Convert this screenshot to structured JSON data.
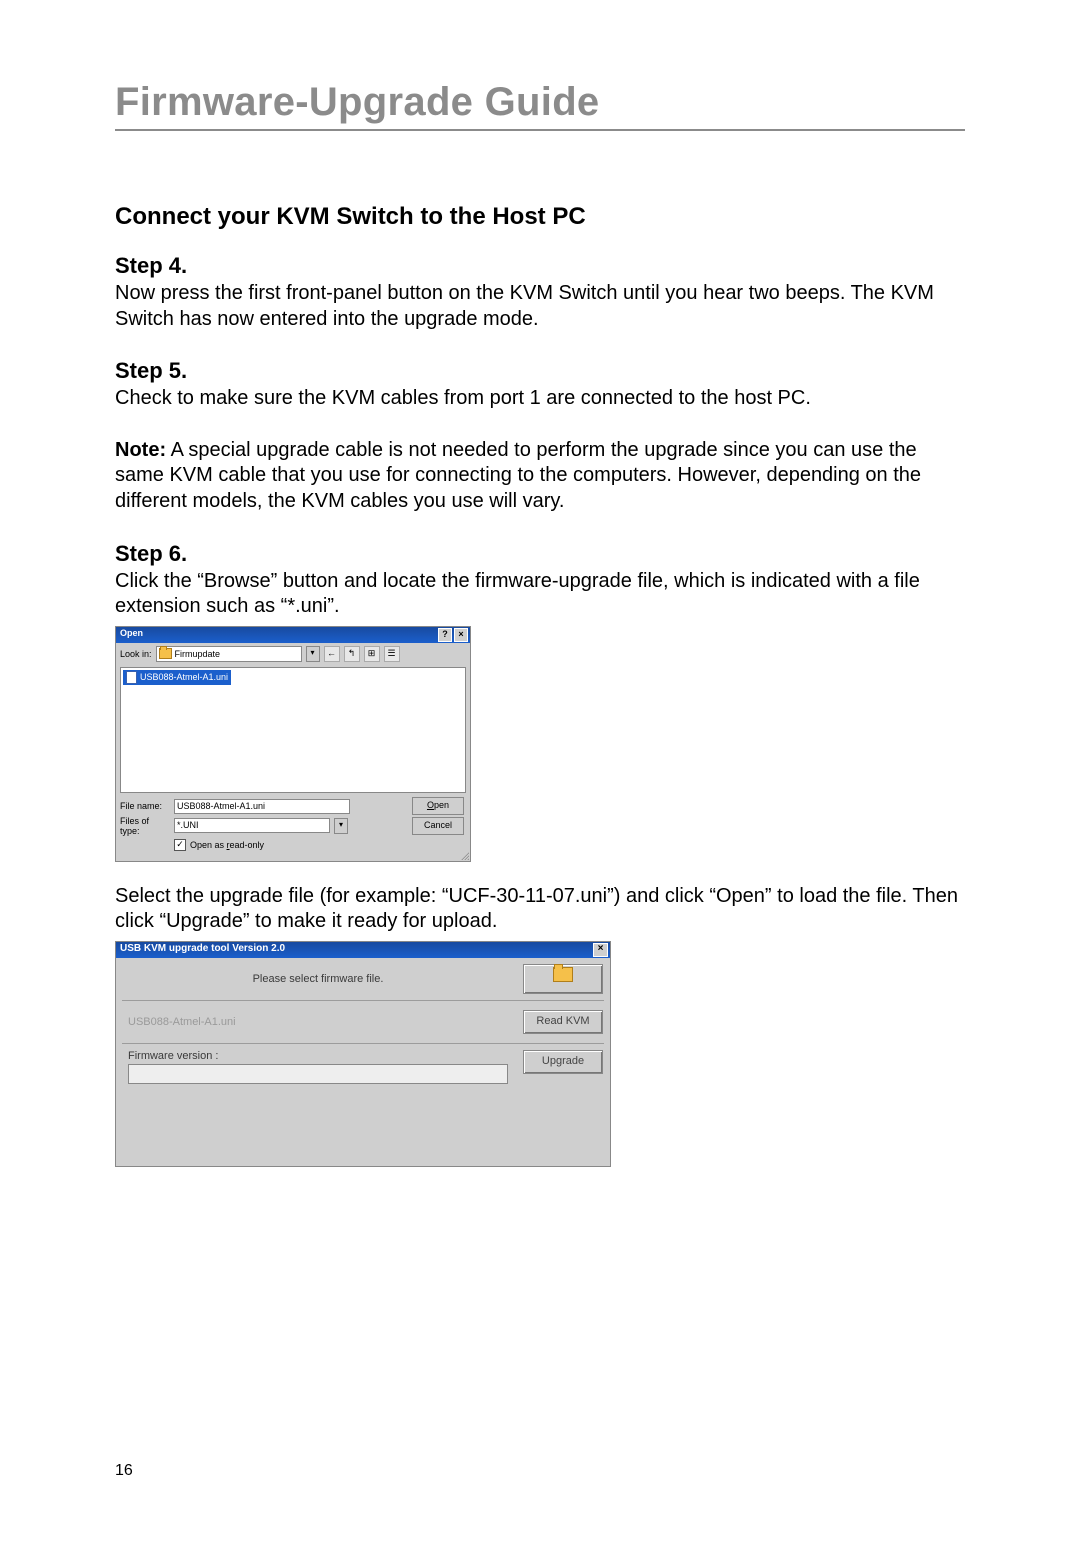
{
  "page": {
    "title": "Firmware-Upgrade Guide",
    "section_title": "Connect your KVM Switch to the Host PC",
    "page_number": "16"
  },
  "step4": {
    "heading": "Step 4.",
    "body": "Now press the first front-panel button on the KVM Switch until you hear two beeps. The KVM Switch has now entered into the upgrade mode."
  },
  "step5": {
    "heading": "Step 5.",
    "body": "Check to make sure the KVM cables from port 1 are connected to the host PC.",
    "note_label": "Note:",
    "note_body": " A special upgrade cable is not needed to perform the upgrade since you can use the same KVM cable that you use for connecting to the computers. However, depending on the different models, the KVM cables you use will vary."
  },
  "step6": {
    "heading": "Step 6.",
    "body1": "Click the “Browse” button and locate the firmware-upgrade file, which is indicated with a file extension such as “*.uni”.",
    "body2": "Select the upgrade file (for example: “UCF-30-11-07.uni”) and click “Open” to load the file. Then click “Upgrade” to make it ready for upload."
  },
  "open_dialog": {
    "title": "Open",
    "help_q": "?",
    "close_x": "×",
    "look_in_label": "Look in:",
    "look_in_value": "Firmupdate",
    "back_arrow": "←",
    "up_icon": "↰",
    "new_icon": "⊞",
    "view_icon": "☰",
    "selected_file": "USB088-Atmel-A1.uni",
    "file_name_label": "File name:",
    "file_name_value": "USB088-Atmel-A1.uni",
    "files_of_type_label": "Files of type:",
    "files_of_type_value": "*.UNI",
    "open_btn_u": "O",
    "open_btn_rest": "pen",
    "cancel_btn": "Cancel",
    "readonly_check": "✓",
    "readonly_label_u": "r",
    "readonly_label_pre": "Open as ",
    "readonly_label_post": "ead-only"
  },
  "upgrade_tool": {
    "title": "USB KVM upgrade tool Version 2.0",
    "close_x": "×",
    "prompt": "Please select firmware file.",
    "file_text": "USB088-Atmel-A1.uni",
    "read_btn": "Read KVM",
    "fw_version_label": "Firmware version :",
    "upgrade_btn": "Upgrade"
  }
}
